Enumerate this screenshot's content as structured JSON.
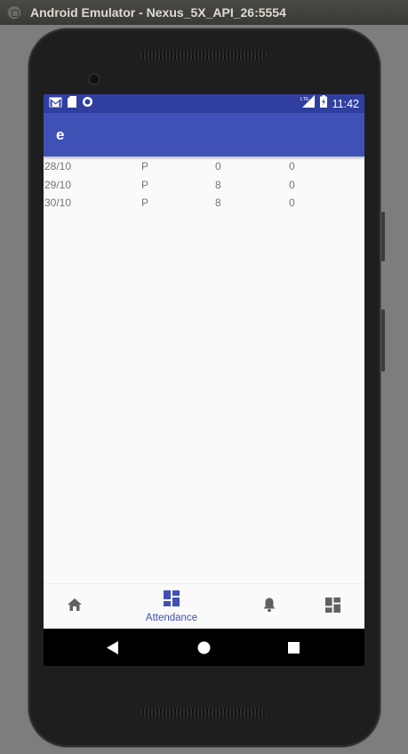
{
  "window": {
    "title": "Android Emulator - Nexus_5X_API_26:5554"
  },
  "status_bar": {
    "time": "11:42",
    "network_label": "LTE",
    "icons": [
      "gmail-icon",
      "sd-card-icon",
      "sync-circle-icon",
      "lte-signal-icon",
      "battery-charging-icon"
    ]
  },
  "app_bar": {
    "title": "e"
  },
  "attendance_rows": [
    {
      "date": "28/10",
      "status": "P",
      "value1": "0",
      "value2": "0"
    },
    {
      "date": "29/10",
      "status": "P",
      "value1": "8",
      "value2": "0"
    },
    {
      "date": "30/10",
      "status": "P",
      "value1": "8",
      "value2": "0"
    }
  ],
  "bottom_nav": {
    "items": [
      {
        "icon": "home-icon",
        "label": ""
      },
      {
        "icon": "dashboard-icon",
        "label": "Attendance",
        "selected": true
      },
      {
        "icon": "bell-icon",
        "label": ""
      },
      {
        "icon": "dashboard-icon",
        "label": ""
      }
    ]
  },
  "colors": {
    "primary": "#3f51b5",
    "primary_dark": "#303f9f",
    "inactive_icon": "#616161",
    "row_text": "#757575"
  }
}
